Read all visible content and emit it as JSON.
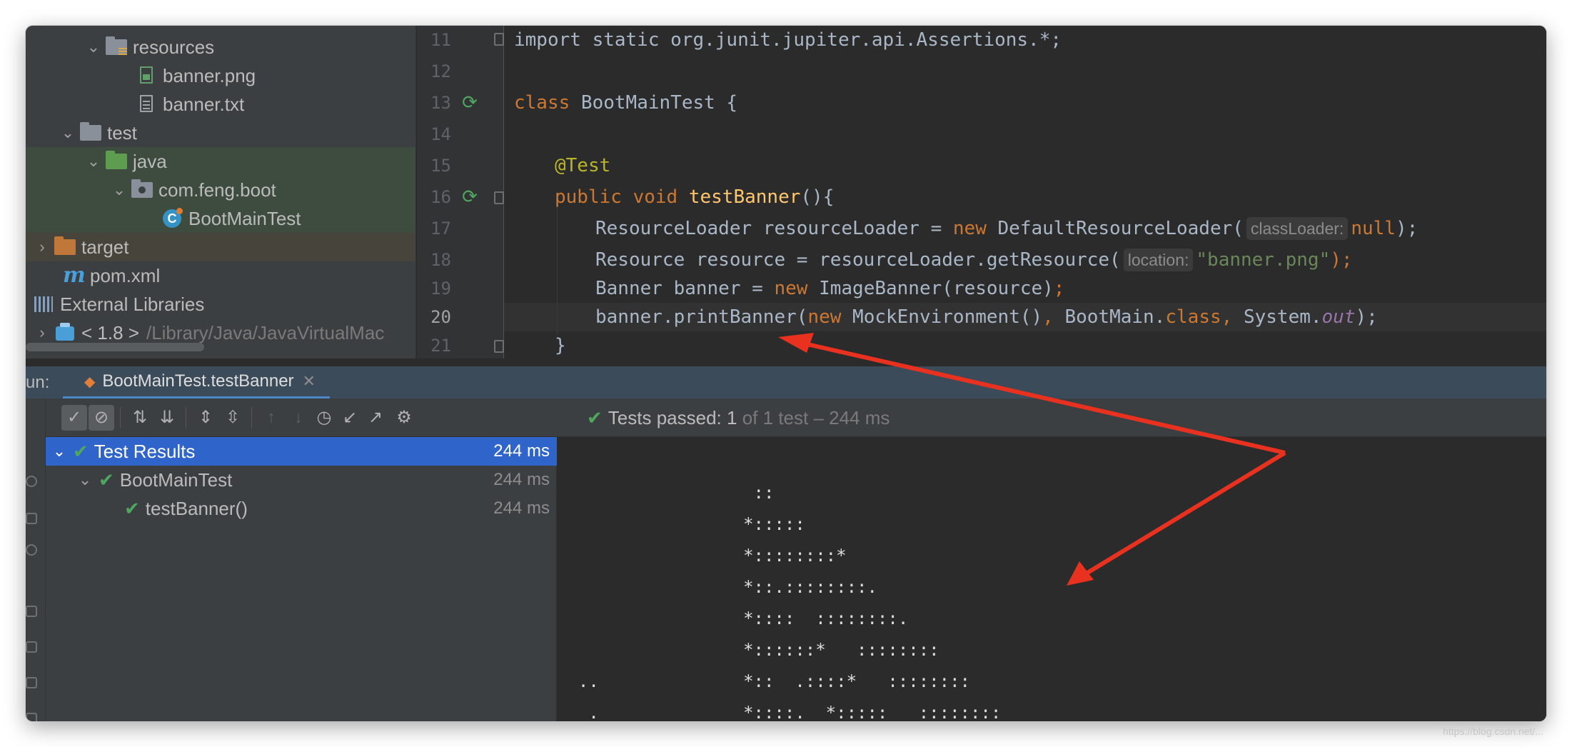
{
  "project_tree": {
    "items": [
      {
        "label": "resources",
        "expanded": true,
        "icon": "resources-folder-icon"
      },
      {
        "label": "banner.png",
        "icon": "image-file-icon"
      },
      {
        "label": "banner.txt",
        "icon": "text-file-icon"
      },
      {
        "label": "test",
        "expanded": true,
        "icon": "folder-icon"
      },
      {
        "label": "java",
        "expanded": true,
        "icon": "test-source-folder-icon"
      },
      {
        "label": "com.feng.boot",
        "expanded": true,
        "icon": "package-icon"
      },
      {
        "label": "BootMainTest",
        "icon": "test-class-icon"
      },
      {
        "label": "target",
        "expanded": false,
        "icon": "excluded-folder-icon"
      },
      {
        "label": "pom.xml",
        "icon": "maven-icon"
      },
      {
        "label": "External Libraries",
        "expanded": false,
        "icon": "libraries-icon"
      },
      {
        "label": "< 1.8 >",
        "detail": "/Library/Java/JavaVirtualMac",
        "expanded": false,
        "icon": "jdk-icon"
      }
    ]
  },
  "editor": {
    "line_numbers": [
      "11",
      "12",
      "13",
      "14",
      "15",
      "16",
      "17",
      "18",
      "19",
      "20",
      "21"
    ],
    "current_line": "20",
    "code": {
      "l11": "import static org.junit.jupiter.api.Assertions.*;",
      "l13_kw": "class",
      "l13_rest": " BootMainTest {",
      "l15": "@Test",
      "l16_kw": "public void",
      "l16_fn": "testBanner",
      "l16_rest": "(){",
      "l17_a": "ResourceLoader resourceLoader = ",
      "l17_new": "new",
      "l17_b": " DefaultResourceLoader(",
      "l17_hint": "classLoader:",
      "l17_null": "null",
      "l17_end": ");",
      "l18_a": "Resource resource = resourceLoader.getResource(",
      "l18_hint": "location:",
      "l18_str": "\"banner.png\"",
      "l18_end": ");",
      "l19_a": "Banner banner = ",
      "l19_new": "new",
      "l19_b": " ImageBanner(resource)",
      "l19_end": ";",
      "l20_a": "banner.printBanner(",
      "l20_new": "new",
      "l20_b": " MockEnvironment()",
      "l20_c": ", ",
      "l20_d": "BootMain.",
      "l20_class": "class",
      "l20_e": ", ",
      "l20_f": "System.",
      "l20_out": "out",
      "l20_end": ");",
      "l21": "}"
    }
  },
  "run_panel": {
    "label": "un:",
    "tab_label": "BootMainTest.testBanner",
    "status_prefix": "Tests passed:",
    "status_count": "1",
    "status_suffix": "of 1 test – 244 ms",
    "results": [
      {
        "label": "Test Results",
        "time": "244 ms",
        "selected": true
      },
      {
        "label": "BootMainTest",
        "time": "244 ms"
      },
      {
        "label": "testBanner()",
        "time": "244 ms"
      }
    ]
  },
  "console": {
    "lines": [
      "                   ::",
      "                  *:::::",
      "                  *::::::::*",
      "                  *::.::::::::.",
      "                  *::::  ::::::::.",
      "                  *::::::*   ::::::::",
      "  ..              *::  .::::*   ::::::::",
      "   .              *::::.  *:::::   ::::::::"
    ]
  },
  "watermark": "https://blog.csdn.net/..."
}
